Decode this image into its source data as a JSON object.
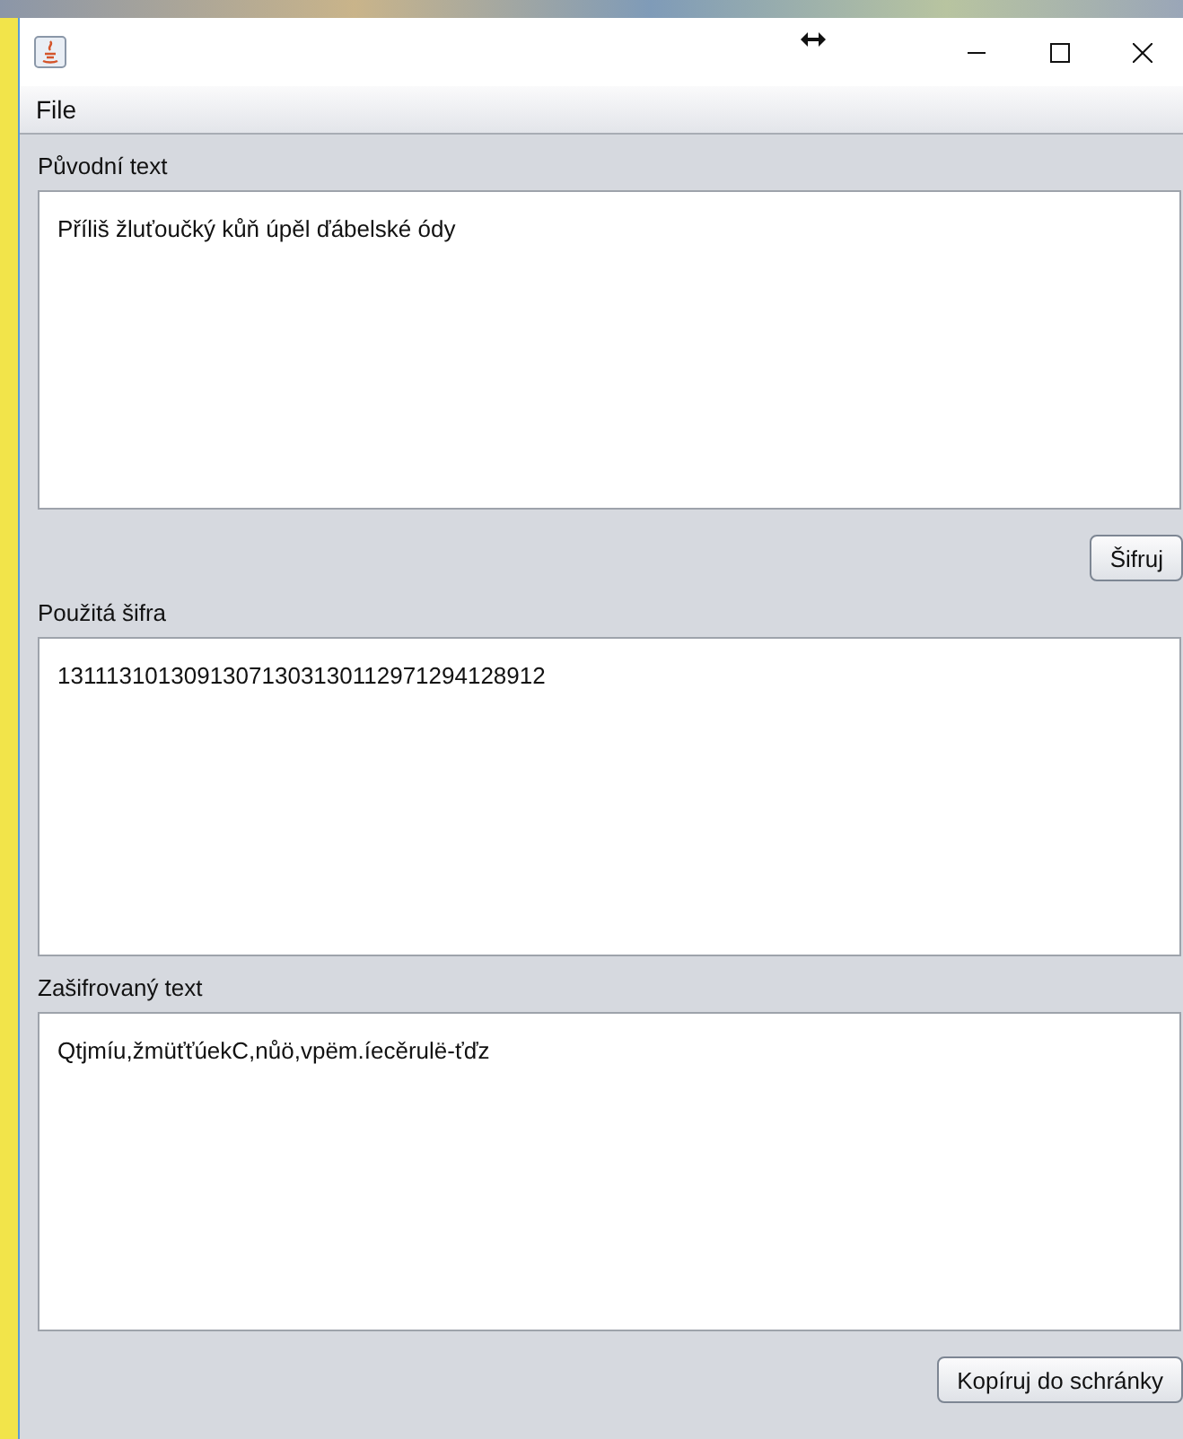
{
  "menu": [
    {
      "label": "File"
    }
  ],
  "sections": [
    {
      "label": "Původní text",
      "value": "Příliš žluťoučký kůň úpěl ďábelské ódy",
      "button": "Šifruj"
    },
    {
      "label": "Použitá šifra",
      "value": "13111310130913071303130112971294128912"
    },
    {
      "label": "Zašifrovaný text",
      "value": "Qtjmíu,žmüťťúekC,nůö,vpëm.íecěrulë-ťďz",
      "button": "Kopíruj do schránky"
    }
  ]
}
